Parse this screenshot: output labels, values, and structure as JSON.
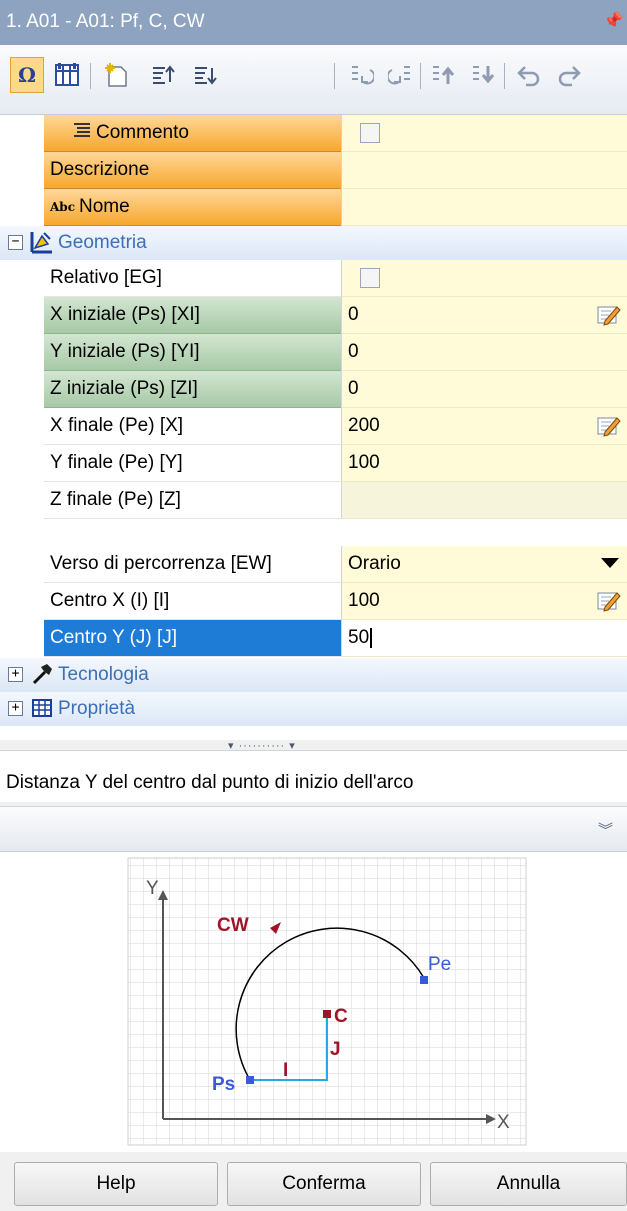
{
  "window": {
    "title": "1. A01 - A01: Pf, C, CW",
    "pin_icon": "pin-icon"
  },
  "toolbar": {
    "buttons": [
      "omega-icon",
      "grid-icon",
      "new-icon",
      "sort-up-icon",
      "sort-down-icon",
      "prev-icon",
      "next-icon",
      "move-up-icon",
      "move-down-icon",
      "undo-icon",
      "redo-icon"
    ]
  },
  "properties": {
    "commento": {
      "label": "Commento",
      "checked": false
    },
    "descrizione": {
      "label": "Descrizione",
      "value": ""
    },
    "nome": {
      "prefix": "Abc",
      "label": "Nome",
      "value": ""
    },
    "geometria": {
      "label": "Geometria",
      "expanded": true
    },
    "relativo": {
      "label": "Relativo [EG]",
      "checked": false
    },
    "x_iniziale": {
      "label": "X iniziale (Ps) [XI]",
      "value": "0"
    },
    "y_iniziale": {
      "label": "Y iniziale (Ps) [YI]",
      "value": "0"
    },
    "z_iniziale": {
      "label": "Z iniziale (Ps) [ZI]",
      "value": "0"
    },
    "x_finale": {
      "label": "X finale (Pe) [X]",
      "value": "200"
    },
    "y_finale": {
      "label": "Y finale (Pe) [Y]",
      "value": "100"
    },
    "z_finale": {
      "label": "Z finale (Pe) [Z]",
      "value": ""
    },
    "verso": {
      "label": "Verso di percorrenza [EW]",
      "value": "Orario"
    },
    "centro_x": {
      "label": "Centro X (I) [I]",
      "value": "100"
    },
    "centro_y": {
      "label": "Centro Y (J) [J]",
      "value": "50"
    },
    "tecnologia": {
      "label": "Tecnologia",
      "expanded": false
    },
    "proprieta": {
      "label": "Proprietà",
      "expanded": false
    }
  },
  "help_text": "Distanza Y del centro dal punto di inizio dell'arco",
  "diagram": {
    "axis_x": "X",
    "axis_y": "Y",
    "direction": "CW",
    "start": "Ps",
    "end": "Pe",
    "center": "C",
    "i_label": "I",
    "j_label": "J",
    "colors": {
      "arc": "#000000",
      "label_blue": "#3a5bd9",
      "label_red": "#a0142a",
      "segment": "#2aa8e0"
    }
  },
  "buttons": {
    "help": "Help",
    "confirm": "Conferma",
    "cancel": "Annulla"
  }
}
